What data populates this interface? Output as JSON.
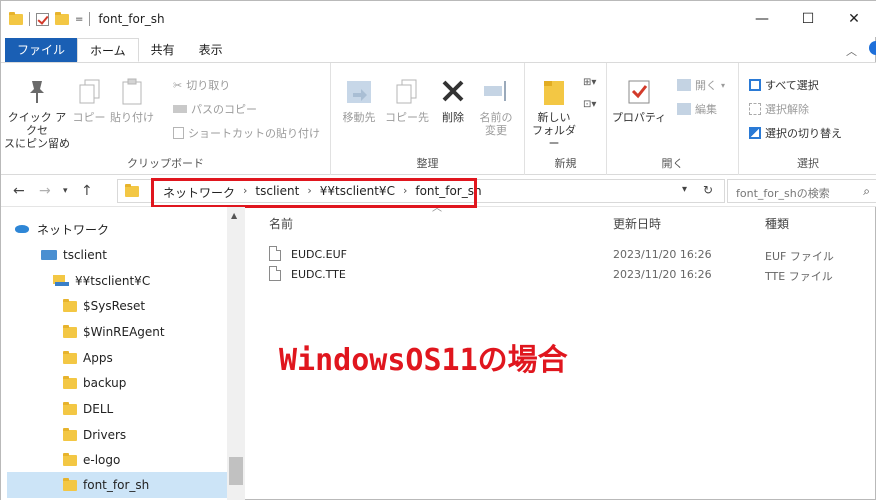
{
  "window": {
    "title": "font_for_sh",
    "qat_dropdown": "=",
    "buttons": {
      "minimize": "—",
      "maximize": "☐",
      "close": "✕"
    }
  },
  "tabs": [
    "ファイル",
    "ホーム",
    "共有",
    "表示"
  ],
  "ribbon": {
    "clipboard": {
      "label": "クリップボード",
      "pin": "クイック アクセ\nスにピン留め",
      "copy": "コピー",
      "paste": "貼り付け",
      "cut": "切り取り",
      "copy_path": "パスのコピー",
      "paste_shortcut": "ショートカットの貼り付け"
    },
    "organize": {
      "label": "整理",
      "move_to": "移動先",
      "copy_to": "コピー先",
      "delete": "削除",
      "rename": "名前の\n変更"
    },
    "new": {
      "label": "新規",
      "new_folder": "新しい\nフォルダー"
    },
    "open": {
      "label": "開く",
      "properties": "プロパティ",
      "open": "開く",
      "edit": "編集"
    },
    "select": {
      "label": "選択",
      "select_all": "すべて選択",
      "select_none": "選択解除",
      "invert": "選択の切り替え"
    }
  },
  "address": {
    "crumbs": [
      "ネットワーク",
      "tsclient",
      "¥¥tsclient¥C",
      "font_for_sh"
    ],
    "search_placeholder": "font_for_shの検索"
  },
  "nav": {
    "items": [
      {
        "label": "ネットワーク",
        "icon": "network-icon"
      },
      {
        "label": "tsclient",
        "icon": "computer-icon"
      },
      {
        "label": "¥¥tsclient¥C",
        "icon": "drive-icon"
      },
      {
        "label": "$SysReset",
        "icon": "folder-icon"
      },
      {
        "label": "$WinREAgent",
        "icon": "folder-icon"
      },
      {
        "label": "Apps",
        "icon": "folder-icon"
      },
      {
        "label": "backup",
        "icon": "folder-icon"
      },
      {
        "label": "DELL",
        "icon": "folder-icon"
      },
      {
        "label": "Drivers",
        "icon": "folder-icon"
      },
      {
        "label": "e-logo",
        "icon": "folder-icon"
      },
      {
        "label": "font_for_sh",
        "icon": "folder-icon"
      }
    ]
  },
  "filelist": {
    "columns": [
      "名前",
      "更新日時",
      "種類"
    ],
    "rows": [
      {
        "name": "EUDC.EUF",
        "date": "2023/11/20 16:26",
        "type": "EUF ファイル"
      },
      {
        "name": "EUDC.TTE",
        "date": "2023/11/20 16:26",
        "type": "TTE ファイル"
      }
    ]
  },
  "annotation": "WindowsOS11の場合",
  "colors": {
    "accent": "#1a5fb4",
    "highlight": "#e0161e",
    "folder": "#f3c744"
  }
}
